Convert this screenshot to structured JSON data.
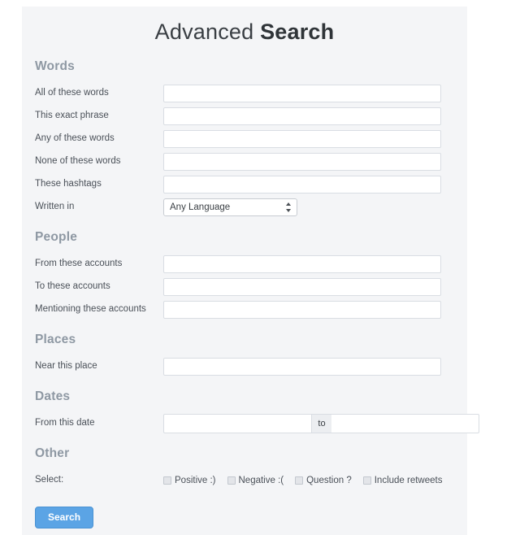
{
  "title": {
    "light": "Advanced ",
    "bold": "Search"
  },
  "sections": {
    "words": {
      "heading": "Words",
      "rows": [
        {
          "label": "All of these words",
          "value": ""
        },
        {
          "label": "This exact phrase",
          "value": ""
        },
        {
          "label": "Any of these words",
          "value": ""
        },
        {
          "label": "None of these words",
          "value": ""
        },
        {
          "label": "These hashtags",
          "value": ""
        }
      ],
      "written_in": {
        "label": "Written in",
        "selected": "Any Language"
      }
    },
    "people": {
      "heading": "People",
      "rows": [
        {
          "label": "From these accounts",
          "value": ""
        },
        {
          "label": "To these accounts",
          "value": ""
        },
        {
          "label": "Mentioning these accounts",
          "value": ""
        }
      ]
    },
    "places": {
      "heading": "Places",
      "rows": [
        {
          "label": "Near this place",
          "value": ""
        }
      ]
    },
    "dates": {
      "heading": "Dates",
      "label": "From this date",
      "from_value": "",
      "separator": "to",
      "to_value": ""
    },
    "other": {
      "heading": "Other",
      "label": "Select:",
      "options": [
        {
          "label": "Positive :)",
          "checked": false
        },
        {
          "label": "Negative :(",
          "checked": false
        },
        {
          "label": "Question ?",
          "checked": false
        },
        {
          "label": "Include retweets",
          "checked": false
        }
      ]
    }
  },
  "submit": {
    "label": "Search"
  },
  "colors": {
    "panel_bg": "#f4f5f7",
    "heading": "#8e98a3",
    "label": "#4a5058",
    "button": "#5ba4e5",
    "field_border": "#d9dde3"
  }
}
